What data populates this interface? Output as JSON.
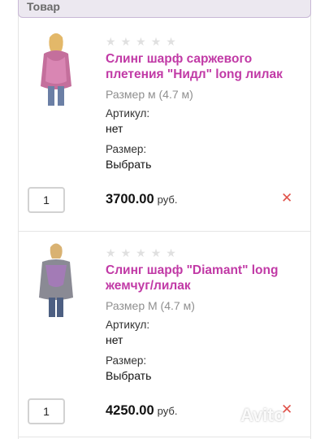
{
  "header": {
    "title": "Товар"
  },
  "items": [
    {
      "rating_stars": 0,
      "title": "Слинг шарф саржевого плетения \"Нидл\" long лилак",
      "size_note": "Размер м (4.7 м)",
      "article_label": "Артикул:",
      "article_value": "нет",
      "size_label": "Размер:",
      "size_value": "Выбрать",
      "quantity": "1",
      "price": "3700.00",
      "currency": "руб.",
      "remove_icon": "close-icon"
    },
    {
      "rating_stars": 0,
      "title": "Слинг шарф \"Diamant\" long жемчуг/лилак",
      "size_note": "Размер М (4.7 м)",
      "article_label": "Артикул:",
      "article_value": "нет",
      "size_label": "Размер:",
      "size_value": "Выбрать",
      "quantity": "1",
      "price": "4250.00",
      "currency": "руб.",
      "remove_icon": "close-icon"
    }
  ],
  "colors": {
    "accent": "#c13aa6",
    "remove": "#e0524a",
    "header_bg": "#ece8f0"
  },
  "watermark": {
    "text": "Avito"
  }
}
